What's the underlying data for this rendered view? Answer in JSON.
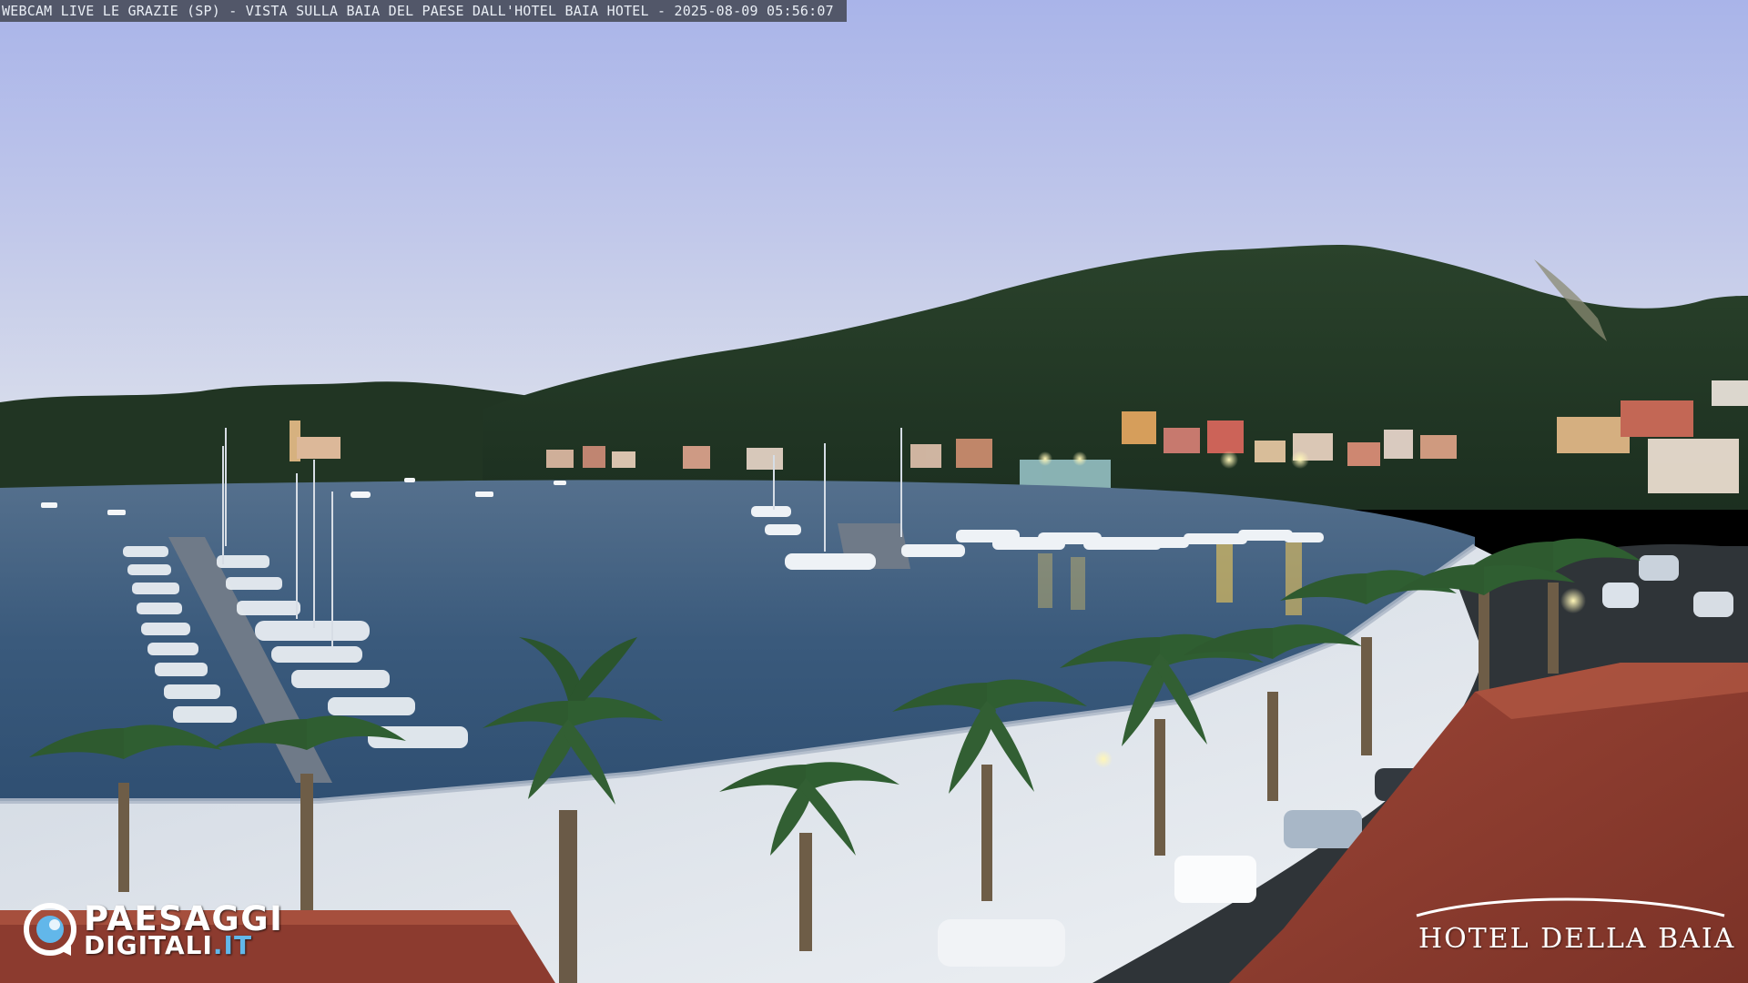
{
  "overlay": {
    "caption": "WEBCAM LIVE LE GRAZIE (SP) - VISTA SULLA BAIA DEL PAESE DALL'HOTEL BAIA HOTEL - 2025-08-09 05:56:07"
  },
  "watermark_left": {
    "line1": "PAESAGGI",
    "line2_prefix": "DIGITALI",
    "line2_suffix": ".IT"
  },
  "watermark_right": {
    "text": "HOTEL DELLA BAIA"
  },
  "colors": {
    "sky_top": "#aeb8ea",
    "sky_mid": "#c6cde8",
    "sky_low": "#d8deec",
    "hills": "#253a27",
    "water": "#3f5f80",
    "promenade": "#d6dde7",
    "roof": "#8a3a2e",
    "accent_logo": "#62b7ea"
  }
}
